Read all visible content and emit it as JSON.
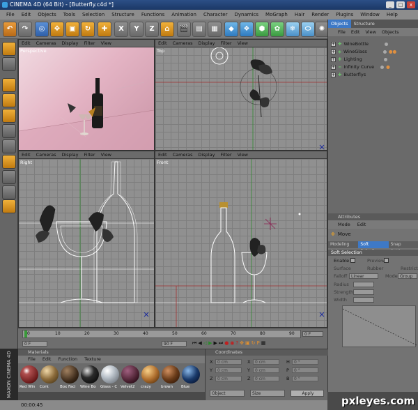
{
  "window": {
    "title": "CINEMA 4D (64 Bit) - [Butterfly.c4d *]",
    "controls": [
      "_",
      "□",
      "x"
    ]
  },
  "menu": [
    "File",
    "Edit",
    "Objects",
    "Tools",
    "Selection",
    "Structure",
    "Functions",
    "Animation",
    "Character",
    "Dynamics",
    "MoGraph",
    "Hair",
    "Render",
    "Plugins",
    "Window",
    "Help"
  ],
  "viewports": {
    "menu": [
      "Edit",
      "Cameras",
      "Display",
      "Filter",
      "View"
    ],
    "perspective": {
      "label": "Perspective"
    },
    "top": {
      "label": "Top"
    },
    "right": {
      "label": "Right"
    },
    "front": {
      "label": "Front"
    }
  },
  "objects_panel": {
    "tabs": [
      "Objects",
      "Structure"
    ],
    "menu": [
      "File",
      "Edit",
      "View",
      "Objects"
    ],
    "items": [
      "WineBottle",
      "WineGlass",
      "Lighting",
      "Infinity Curve",
      "Butterflys"
    ]
  },
  "attributes_panel": {
    "title": "Attributes",
    "menu": [
      "Mode",
      "Edit"
    ],
    "tool": "Move",
    "tabs": [
      "Modeling Axis",
      "Soft Selection",
      "Snap Settings"
    ],
    "section": "Soft Selection",
    "fields": {
      "enable": "Enable",
      "preview": "Preview",
      "surface": "Surface",
      "rubber": "Rubber",
      "restrict": "Restrict",
      "falloff_label": "Falloff",
      "falloff_value": "Linear",
      "mode_label": "Mode",
      "mode_value": "Group",
      "radius": "Radius",
      "strength": "Strength",
      "width": "Width"
    }
  },
  "timeline": {
    "ticks": [
      "0",
      "10",
      "20",
      "30",
      "40",
      "50",
      "60",
      "70",
      "80",
      "90"
    ],
    "start_frame": "0 F",
    "end_frame": "90 F",
    "current_frame": "0 F",
    "right_frame": "0 F"
  },
  "materials": {
    "title": "Materials",
    "menu": [
      "File",
      "Edit",
      "Function",
      "Texture"
    ],
    "items": [
      {
        "name": "Red Win",
        "color": "#6b1a1a"
      },
      {
        "name": "Cork",
        "color": "#8a6a3a"
      },
      {
        "name": "Box Faci",
        "color": "#3c2a1a"
      },
      {
        "name": "Wine Bo",
        "color": "#2a2a2a"
      },
      {
        "name": "Glass - C",
        "color": "#b8c0c8"
      },
      {
        "name": "Velvet2",
        "color": "#4a2030"
      },
      {
        "name": "crazy",
        "color": "#b07030"
      },
      {
        "name": "brown",
        "color": "#6a3c1a"
      },
      {
        "name": "Blue",
        "color": "#1a3a6a"
      }
    ]
  },
  "coordinates": {
    "title": "Coordinates",
    "rows": [
      {
        "a": "X",
        "av": "0 cm",
        "b": "X",
        "bv": "0 cm",
        "c": "H",
        "cv": "0 °"
      },
      {
        "a": "Y",
        "av": "0 cm",
        "b": "Y",
        "bv": "0 cm",
        "c": "P",
        "cv": "0 °"
      },
      {
        "a": "Z",
        "av": "0 cm",
        "b": "Z",
        "bv": "0 cm",
        "c": "B",
        "cv": "0 °"
      }
    ],
    "mode": "Object",
    "size_mode": "Size",
    "apply": "Apply"
  },
  "status": {
    "time": "00:00:45"
  },
  "branding": {
    "maxon": "MAXON CINEMA 4D",
    "watermark": "pxleyes.com"
  }
}
